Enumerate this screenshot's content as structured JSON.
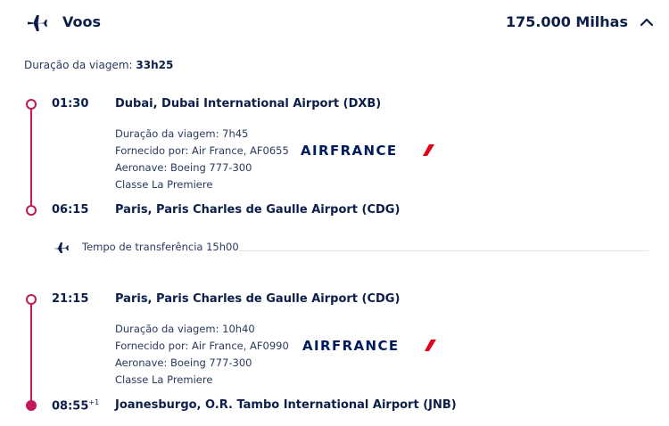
{
  "header": {
    "title": "Voos",
    "miles": "175.000 Milhas"
  },
  "trip": {
    "duration_label": "Duração da viagem: ",
    "duration_value": "33h25"
  },
  "segments": [
    {
      "depart_time": "01:30",
      "depart_place": "Dubai, Dubai International Airport (DXB)",
      "duration": "Duração da viagem: 7h45",
      "operated": "Fornecido por: Air France, AF0655",
      "aircraft": "Aeronave: Boeing 777-300",
      "cabin": "Classe La Premiere",
      "airline_logo": "AIRFRANCE",
      "arrive_time": "06:15",
      "arrive_place": "Paris, Paris Charles de Gaulle Airport (CDG)"
    },
    {
      "depart_time": "21:15",
      "depart_place": "Paris, Paris Charles de Gaulle Airport (CDG)",
      "duration": "Duração da viagem: 10h40",
      "operated": "Fornecido por: Air France, AF0990",
      "aircraft": "Aeronave: Boeing 777-300",
      "cabin": "Classe La Premiere",
      "airline_logo": "AIRFRANCE",
      "arrive_time": "08:55",
      "arrive_day_offset": "+1",
      "arrive_place": "Joanesburgo, O.R. Tambo International Airport (JNB)"
    }
  ],
  "transfer": {
    "text": "Tempo de transferência 15h00"
  },
  "colors": {
    "accent": "#c2185b",
    "navy": "#0b1f4a",
    "airfrance_blue": "#001b60",
    "airfrance_red": "#e2001a"
  }
}
